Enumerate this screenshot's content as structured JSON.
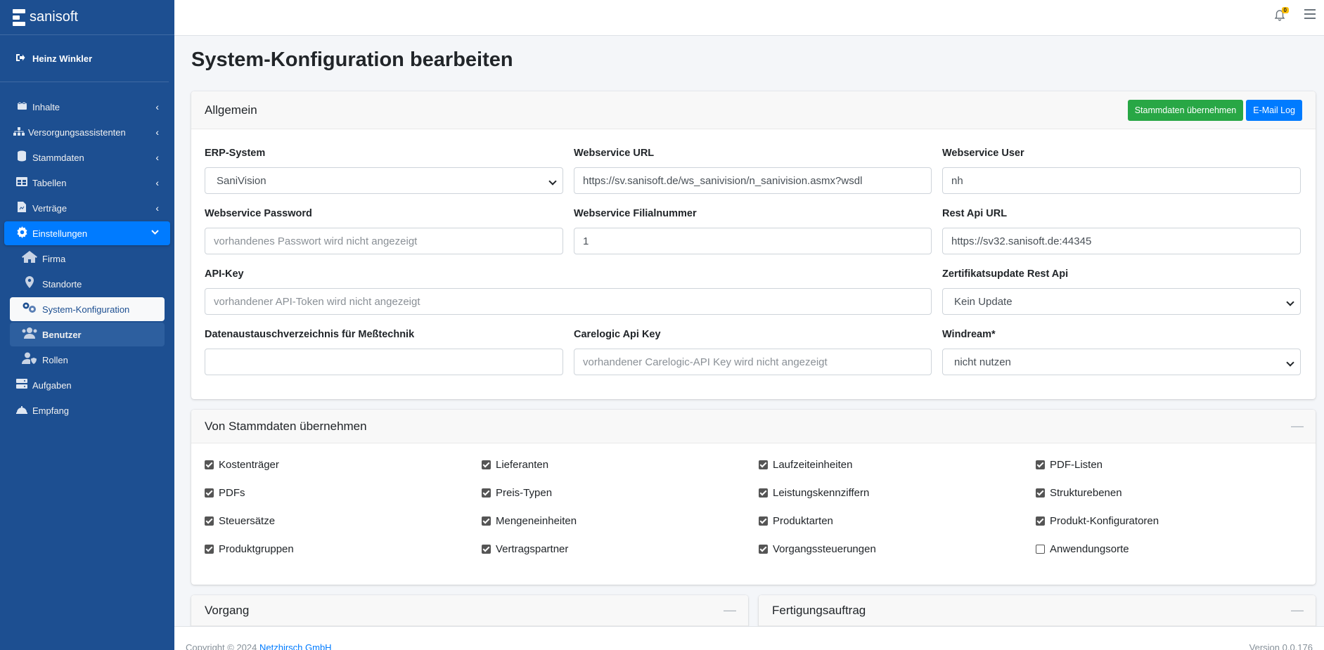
{
  "brand": {
    "name": "sanisoft"
  },
  "user": {
    "name": "Heinz Winkler"
  },
  "sidebar": {
    "items": [
      {
        "label": "Inhalte",
        "icon": "content-icon",
        "has_children": true
      },
      {
        "label": "Versorgungsassistenten",
        "icon": "sitemap-icon",
        "has_children": true
      },
      {
        "label": "Stammdaten",
        "icon": "database-icon",
        "has_children": true
      },
      {
        "label": "Tabellen",
        "icon": "table-icon",
        "has_children": true
      },
      {
        "label": "Verträge",
        "icon": "contract-icon",
        "has_children": true
      },
      {
        "label": "Einstellungen",
        "icon": "gear-icon",
        "has_children": true,
        "expanded": true
      }
    ],
    "subitems": [
      {
        "label": "Firma",
        "icon": "home-icon"
      },
      {
        "label": "Standorte",
        "icon": "map-marker-icon"
      },
      {
        "label": "System-Konfiguration",
        "icon": "cogs-icon",
        "selected": true
      },
      {
        "label": "Benutzer",
        "icon": "users-icon"
      },
      {
        "label": "Rollen",
        "icon": "user-shield-icon"
      }
    ],
    "bottom_items": [
      {
        "label": "Aufgaben",
        "icon": "tasks-icon"
      },
      {
        "label": "Empfang",
        "icon": "bell-concierge-icon"
      }
    ]
  },
  "topbar": {
    "notification_count": "0"
  },
  "page": {
    "title": "System-Konfiguration bearbeiten"
  },
  "general": {
    "title": "Allgemein",
    "btn_stammdaten": "Stammdaten übernehmen",
    "btn_email_log": "E-Mail Log",
    "erp_label": "ERP-System",
    "erp_value": "SaniVision",
    "ws_url_label": "Webservice URL",
    "ws_url_value": "https://sv.sanisoft.de/ws_sanivision/n_sanivision.asmx?wsdl",
    "ws_user_label": "Webservice User",
    "ws_user_value": "nh",
    "ws_pw_label": "Webservice Password",
    "ws_pw_placeholder": "vorhandenes Passwort wird nicht angezeigt",
    "ws_branch_label": "Webservice Filialnummer",
    "ws_branch_value": "1",
    "rest_url_label": "Rest Api URL",
    "rest_url_value": "https://sv32.sanisoft.de:44345",
    "api_key_label": "API-Key",
    "api_key_placeholder": "vorhandener API-Token wird nicht angezeigt",
    "cert_label": "Zertifikatsupdate Rest Api",
    "cert_value": "Kein Update",
    "exchange_dir_label": "Datenaustauschverzeichnis für Meßtechnik",
    "exchange_dir_value": "",
    "carelogic_label": "Carelogic Api Key",
    "carelogic_placeholder": "vorhandener Carelogic-API Key wird nicht angezeigt",
    "windream_label": "Windream*",
    "windream_value": "nicht nutzen"
  },
  "import": {
    "title": "Von Stammdaten übernehmen",
    "collapse": "—",
    "options": [
      {
        "label": "Kostenträger",
        "checked": true
      },
      {
        "label": "Lieferanten",
        "checked": true
      },
      {
        "label": "Laufzeiteinheiten",
        "checked": true
      },
      {
        "label": "PDF-Listen",
        "checked": true
      },
      {
        "label": "PDFs",
        "checked": true
      },
      {
        "label": "Preis-Typen",
        "checked": true
      },
      {
        "label": "Leistungskennziffern",
        "checked": true
      },
      {
        "label": "Strukturebenen",
        "checked": true
      },
      {
        "label": "Steuersätze",
        "checked": true
      },
      {
        "label": "Mengeneinheiten",
        "checked": true
      },
      {
        "label": "Produktarten",
        "checked": true
      },
      {
        "label": "Produkt-Konfiguratoren",
        "checked": true
      },
      {
        "label": "Produktgruppen",
        "checked": true
      },
      {
        "label": "Vertragspartner",
        "checked": true
      },
      {
        "label": "Vorgangssteuerungen",
        "checked": true
      },
      {
        "label": "Anwendungsorte",
        "checked": false
      }
    ]
  },
  "vorgang": {
    "title": "Vorgang",
    "collapse": "—"
  },
  "fertigung": {
    "title": "Fertigungsauftrag",
    "collapse": "—"
  },
  "footer": {
    "copyright": "Copyright © 2024",
    "company": "Netzhirsch GmbH",
    "version": "Version 0.0.176"
  }
}
